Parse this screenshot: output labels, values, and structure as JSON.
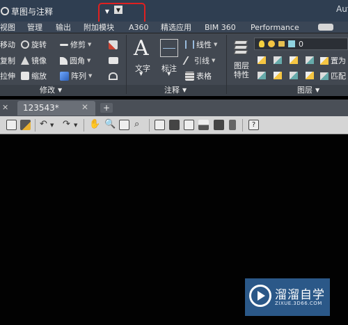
{
  "titlebar": {
    "workspace": "草图与注释",
    "app_title": "Aut"
  },
  "ribbon_tabs": [
    "视图",
    "管理",
    "输出",
    "附加模块",
    "A360",
    "精选应用",
    "BIM 360",
    "Performance"
  ],
  "modify_panel": {
    "title": "修改",
    "tools": [
      "移动",
      "旋转",
      "修剪",
      "复制",
      "镜像",
      "圆角",
      "拉伸",
      "缩放",
      "阵列"
    ]
  },
  "annotation_panel": {
    "title": "注释",
    "text_label": "文字",
    "dim_label": "标注",
    "linear_label": "线性",
    "leader_label": "引线",
    "table_label": "表格"
  },
  "layers_panel": {
    "title": "图层",
    "properties_label": "图层\n特性",
    "current_layer": "0",
    "set_current_label": "置为",
    "match_label": "匹配"
  },
  "document": {
    "tab_label": "123543*",
    "new_tab_symbol": "+"
  },
  "watermark": {
    "name": "溜溜自学",
    "url": "ZIXUE.3D66.COM"
  },
  "colors": {
    "titlebar": "#2f3e51",
    "ribbon": "#424851",
    "highlight": "#e02020",
    "watermark": "#2f5f94"
  }
}
